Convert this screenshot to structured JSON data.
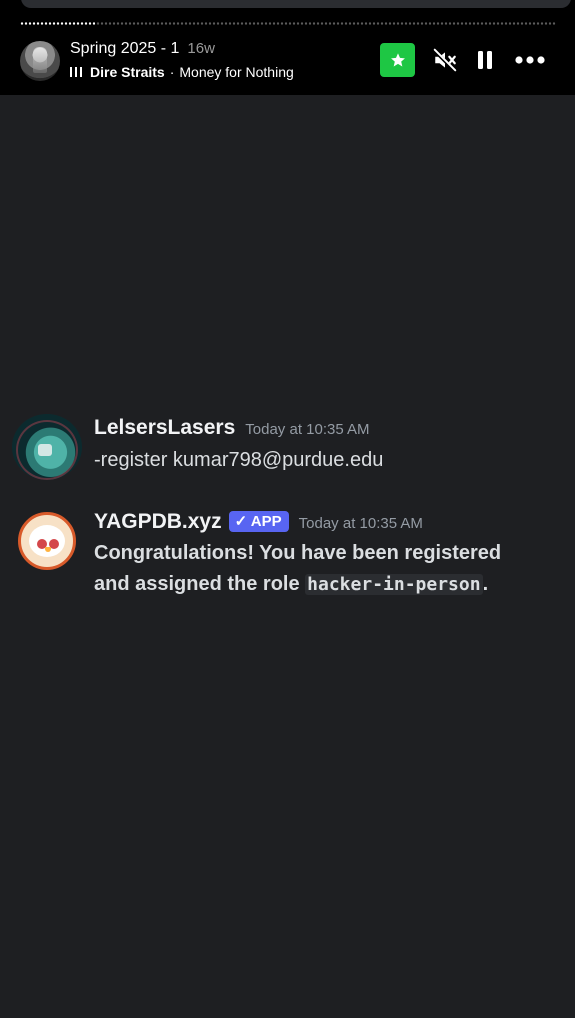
{
  "now_playing": {
    "title": "Spring 2025 - 1",
    "age": "16w",
    "artist": "Dire Straits",
    "separator": "·",
    "track": "Money for Nothing",
    "progress": 0.14,
    "icons": [
      "equalizer-icon",
      "star-icon",
      "mute-icon",
      "pause-icon",
      "more-icon"
    ],
    "accent_color": "#1ec744"
  },
  "messages": [
    {
      "author": "LelsersLasers",
      "timestamp": "Today at 10:35 AM",
      "content": "-register kumar798@purdue.edu"
    },
    {
      "author": "YAGPDB.xyz",
      "badge": "✓ APP",
      "timestamp": "Today at 10:35 AM",
      "content_line1": "Congratulations! You have been registered",
      "content_line2_prefix": "and assigned the role ",
      "content_code": "hacker-in-person",
      "content_line2_suffix": "."
    }
  ]
}
